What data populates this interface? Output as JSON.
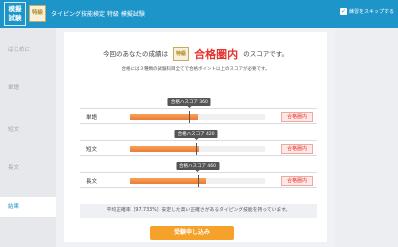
{
  "header": {
    "logo_line1": "模擬",
    "logo_line2": "試験",
    "grade_badge": "特級",
    "title": "タイピング技能検定 特級 模擬試験",
    "skip_label": "練習をスキップする",
    "skip_checked": true
  },
  "sidebar": {
    "items": [
      {
        "label": "はじめに"
      },
      {
        "label": "単語"
      },
      {
        "label": "短文"
      },
      {
        "label": "長文"
      },
      {
        "label": "結果"
      }
    ],
    "active_index": 4
  },
  "result": {
    "prefix": "今回のあなたの成績は",
    "grade": "特級",
    "outcome": "合格圏内",
    "suffix": "のスコアです。",
    "note": "合格には３種類の試験科目全てで合格ボイント以上のスコアが必要です。"
  },
  "rows": [
    {
      "label": "単語",
      "threshold_label": "合格ハスコア 360",
      "threshold_fraction": 0.44,
      "score_fraction": 0.5,
      "status": "合格圏内"
    },
    {
      "label": "短文",
      "threshold_label": "合格ハスコア 420",
      "threshold_fraction": 0.49,
      "score_fraction": 0.51,
      "status": "合格圏内"
    },
    {
      "label": "長文",
      "threshold_label": "合格ハスコア 460",
      "threshold_fraction": 0.5,
      "score_fraction": 0.56,
      "status": "合格圏内"
    }
  ],
  "summary": "平均正確率［97.733%］安定した高い正確さがあるタイピング技能を持っています。",
  "apply_button": "受験申し込み",
  "colors": {
    "header": "#1e95c9",
    "pass_text": "#e5322d",
    "bar": "#ee7a35",
    "apply": "#f5a12a"
  }
}
